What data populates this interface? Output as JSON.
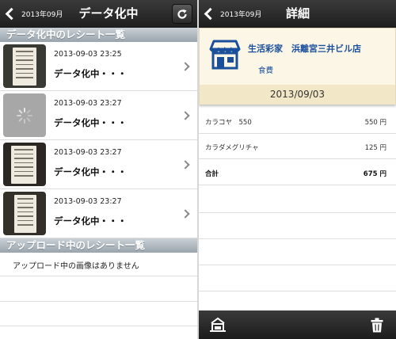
{
  "left_screen": {
    "nav": {
      "back_label": "2013年09月",
      "title": "データ化中",
      "refresh_icon": "refresh-icon"
    },
    "processing_section": {
      "header": "データ化中のレシート一覧",
      "rows": [
        {
          "date": "2013-09-03 23:25",
          "status": "データ化中・・・",
          "thumb": "receipt-photo"
        },
        {
          "date": "2013-09-03 23:27",
          "status": "データ化中・・・",
          "thumb": "loading-spinner"
        },
        {
          "date": "2013-09-03 23:27",
          "status": "データ化中・・・",
          "thumb": "receipt-photo"
        },
        {
          "date": "2013-09-03 23:27",
          "status": "データ化中・・・",
          "thumb": "receipt-photo"
        }
      ]
    },
    "uploading_section": {
      "header": "アップロード中のレシート一覧",
      "empty_message": "アップロード中の画像はありません"
    }
  },
  "right_screen": {
    "nav": {
      "back_label": "2013年09月",
      "title": "詳細"
    },
    "store": {
      "icon": "store-icon",
      "name": "生活彩家　浜離宮三井ビル店",
      "category": "食費",
      "date": "2013/09/03"
    },
    "items": [
      {
        "name": "カラコヤ　550",
        "price": "550 円"
      },
      {
        "name": "カラダメグリチャ",
        "price": "125 円"
      }
    ],
    "total": {
      "label": "合計",
      "price": "675 円"
    },
    "toolbar": {
      "left_icon": "upload-receipt-icon",
      "right_icon": "trash-icon"
    }
  },
  "colors": {
    "navbar": "#2b2b2b",
    "section_header": "#aeb6bd",
    "store_text": "#1a4f9c",
    "store_card": "#fbf6e6"
  }
}
